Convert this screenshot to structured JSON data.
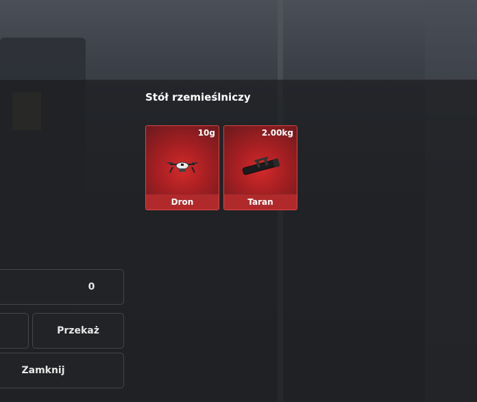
{
  "crafting": {
    "title": "Stół rzemieślniczy",
    "items": [
      {
        "name": "Dron",
        "weight": "10g",
        "icon": "drone-icon"
      },
      {
        "name": "Taran",
        "weight": "2.00kg",
        "icon": "battering-ram-icon"
      }
    ]
  },
  "controls": {
    "quantity": "0",
    "transfer_label": "Przekaż",
    "close_label": "Zamknij"
  },
  "colors": {
    "tile_red": "#d42a2a",
    "tile_border": "#e04545",
    "panel_bg": "#1c1d20"
  }
}
